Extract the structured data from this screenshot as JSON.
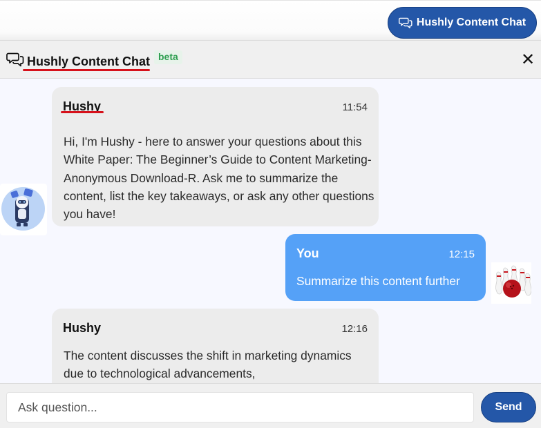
{
  "topbar": {
    "launch_label": "Hushly Content Chat"
  },
  "chat": {
    "title": "Hushly Content Chat",
    "badge": "beta",
    "close_glyph": "✕",
    "messages": [
      {
        "sender": "Hushy",
        "time": "11:54",
        "text": "Hi, I'm Hushy - here to answer your questions about this White Paper: The Beginner’s Guide to Content Marketing-Anonymous Download-R. Ask me to summarize the content, list the key takeaways, or ask any other questions you have!"
      },
      {
        "sender": "You",
        "time": "12:15",
        "text": "Summarize this content further"
      },
      {
        "sender": "Hushy",
        "time": "12:16",
        "text": "The content discusses the shift in marketing dynamics due to technological advancements,"
      }
    ]
  },
  "input": {
    "placeholder": "Ask question...",
    "value": ""
  },
  "send_label": "Send",
  "icons": {
    "chat": "chat-bubbles-icon",
    "close": "close-icon",
    "bot_avatar": "robot-avatar-icon",
    "user_avatar": "bowling-avatar-icon"
  },
  "colors": {
    "primary": "#2457a8",
    "user_bubble": "#55a1f7",
    "bot_bubble": "#ececec",
    "accent_red": "#d6111b",
    "beta_green": "#2e9f50"
  }
}
